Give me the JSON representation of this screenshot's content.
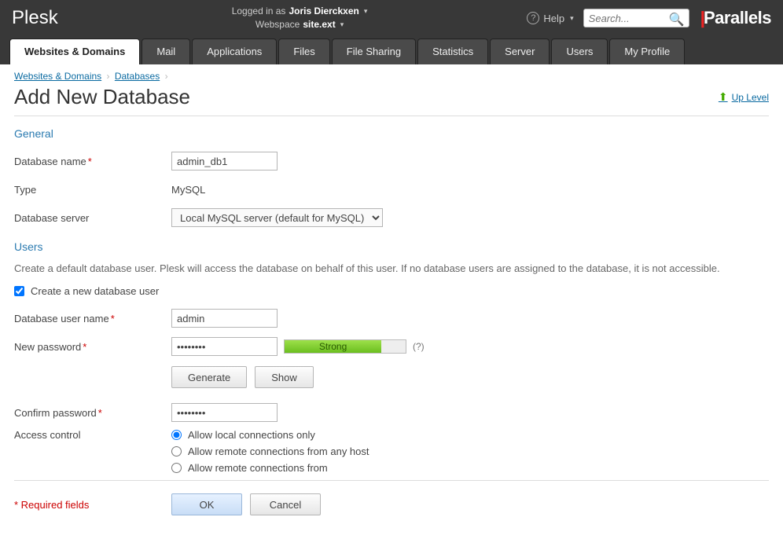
{
  "topbar": {
    "brand": "Plesk",
    "logged_in_label": "Logged in as",
    "logged_in_user": "Joris Dierckxen",
    "webspace_label": "Webspace",
    "webspace_value": "site.ext",
    "help_label": "Help",
    "search_placeholder": "Search...",
    "partner": "Parallels"
  },
  "tabs": [
    "Websites & Domains",
    "Mail",
    "Applications",
    "Files",
    "File Sharing",
    "Statistics",
    "Server",
    "Users",
    "My Profile"
  ],
  "active_tab": 0,
  "breadcrumb": {
    "a": "Websites & Domains",
    "b": "Databases"
  },
  "page_title": "Add New Database",
  "up_level": "Up Level",
  "sections": {
    "general": {
      "title": "General"
    },
    "users": {
      "title": "Users",
      "desc": "Create a default database user. Plesk will access the database on behalf of this user. If no database users are assigned to the database, it is not accessible."
    }
  },
  "labels": {
    "db_name": "Database name",
    "type": "Type",
    "db_server": "Database server",
    "create_user": "Create a new database user",
    "db_user_name": "Database user name",
    "new_password": "New password",
    "confirm_password": "Confirm password",
    "access_control": "Access control",
    "required": "* Required fields"
  },
  "values": {
    "db_name": "admin_db1",
    "type": "MySQL",
    "db_server_selected": "Local MySQL server (default for MySQL)",
    "db_user_name": "admin",
    "password": "••••••••",
    "confirm": "••••••••",
    "strength_label": "Strong"
  },
  "buttons": {
    "generate": "Generate",
    "show": "Show",
    "ok": "OK",
    "cancel": "Cancel"
  },
  "access_options": [
    "Allow local connections only",
    "Allow remote connections from any host",
    "Allow remote connections from"
  ],
  "access_selected": 0,
  "hint_q": "(?)"
}
